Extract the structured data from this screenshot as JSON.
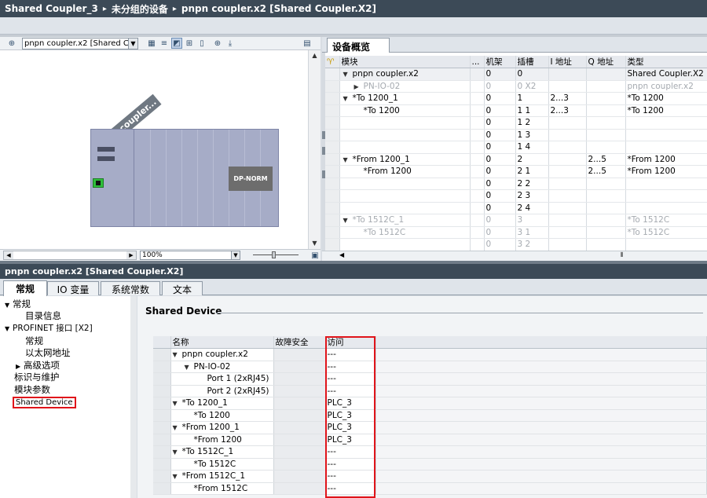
{
  "breadcrumb": [
    "Shared Coupler_3",
    "未分组的设备",
    "pnpn coupler.x2 [Shared Coupler.X2]"
  ],
  "graphic_view": {
    "device_select": "pnpn coupler.x2 [Shared Cou",
    "device_label": "pnpn coupler...",
    "module_label": "DP-NORM",
    "zoom": "100%"
  },
  "overview": {
    "tab": "设备概览",
    "columns": [
      "模块",
      "...",
      "机架",
      "插槽",
      "I 地址",
      "Q 地址",
      "类型"
    ],
    "rows": [
      {
        "name": "pnpn coupler.x2",
        "rack": "0",
        "slot": "0",
        "i": "",
        "q": "",
        "type": "Shared Coupler.X2",
        "style": "sel"
      },
      {
        "name": "PN-IO-02",
        "rack": "0",
        "slot": "0 X2",
        "i": "",
        "q": "",
        "type": "pnpn coupler.x2",
        "style": "gray"
      },
      {
        "name": "*To 1200_1",
        "rack": "0",
        "slot": "1",
        "i": "2...3",
        "q": "",
        "type": "*To 1200",
        "style": ""
      },
      {
        "name": "*To 1200",
        "rack": "0",
        "slot": "1 1",
        "i": "2...3",
        "q": "",
        "type": "*To 1200",
        "style": ""
      },
      {
        "name": "",
        "rack": "0",
        "slot": "1 2",
        "i": "",
        "q": "",
        "type": "",
        "style": ""
      },
      {
        "name": "",
        "rack": "0",
        "slot": "1 3",
        "i": "",
        "q": "",
        "type": "",
        "style": ""
      },
      {
        "name": "",
        "rack": "0",
        "slot": "1 4",
        "i": "",
        "q": "",
        "type": "",
        "style": ""
      },
      {
        "name": "*From 1200_1",
        "rack": "0",
        "slot": "2",
        "i": "",
        "q": "2...5",
        "type": "*From 1200",
        "style": ""
      },
      {
        "name": "*From 1200",
        "rack": "0",
        "slot": "2 1",
        "i": "",
        "q": "2...5",
        "type": "*From 1200",
        "style": ""
      },
      {
        "name": "",
        "rack": "0",
        "slot": "2 2",
        "i": "",
        "q": "",
        "type": "",
        "style": ""
      },
      {
        "name": "",
        "rack": "0",
        "slot": "2 3",
        "i": "",
        "q": "",
        "type": "",
        "style": ""
      },
      {
        "name": "",
        "rack": "0",
        "slot": "2 4",
        "i": "",
        "q": "",
        "type": "",
        "style": ""
      },
      {
        "name": "*To 1512C_1",
        "rack": "0",
        "slot": "3",
        "i": "",
        "q": "",
        "type": "*To 1512C",
        "style": "gray"
      },
      {
        "name": "*To 1512C",
        "rack": "0",
        "slot": "3 1",
        "i": "",
        "q": "",
        "type": "*To 1512C",
        "style": "gray"
      },
      {
        "name": "",
        "rack": "0",
        "slot": "3 2",
        "i": "",
        "q": "",
        "type": "",
        "style": "gray"
      }
    ]
  },
  "properties": {
    "title": "pnpn coupler.x2 [Shared Coupler.X2]",
    "tabs": [
      "常规",
      "IO 变量",
      "系统常数",
      "文本"
    ],
    "tree": [
      "常规",
      "目录信息",
      "PROFINET 接口 [X2]",
      "常规",
      "以太网地址",
      "高级选项",
      "标识与维护",
      "模块参数",
      "Shared Device"
    ],
    "section_title": "Shared Device",
    "columns": [
      "名称",
      "故障安全",
      "访问"
    ],
    "rows": [
      {
        "name": "pnpn coupler.x2",
        "fs": "",
        "access": "---"
      },
      {
        "name": "PN-IO-02",
        "fs": "",
        "access": "---"
      },
      {
        "name": "Port 1 (2xRJ45)",
        "fs": "",
        "access": "---"
      },
      {
        "name": "Port 2 (2xRJ45)",
        "fs": "",
        "access": "---"
      },
      {
        "name": "*To 1200_1",
        "fs": "",
        "access": "PLC_3"
      },
      {
        "name": "*To 1200",
        "fs": "",
        "access": "PLC_3"
      },
      {
        "name": "*From 1200_1",
        "fs": "",
        "access": "PLC_3"
      },
      {
        "name": "*From 1200",
        "fs": "",
        "access": "PLC_3"
      },
      {
        "name": "*To 1512C_1",
        "fs": "",
        "access": "---"
      },
      {
        "name": "*To 1512C",
        "fs": "",
        "access": "---"
      },
      {
        "name": "*From 1512C_1",
        "fs": "",
        "access": "---"
      },
      {
        "name": "*From 1512C",
        "fs": "",
        "access": "---"
      }
    ]
  }
}
